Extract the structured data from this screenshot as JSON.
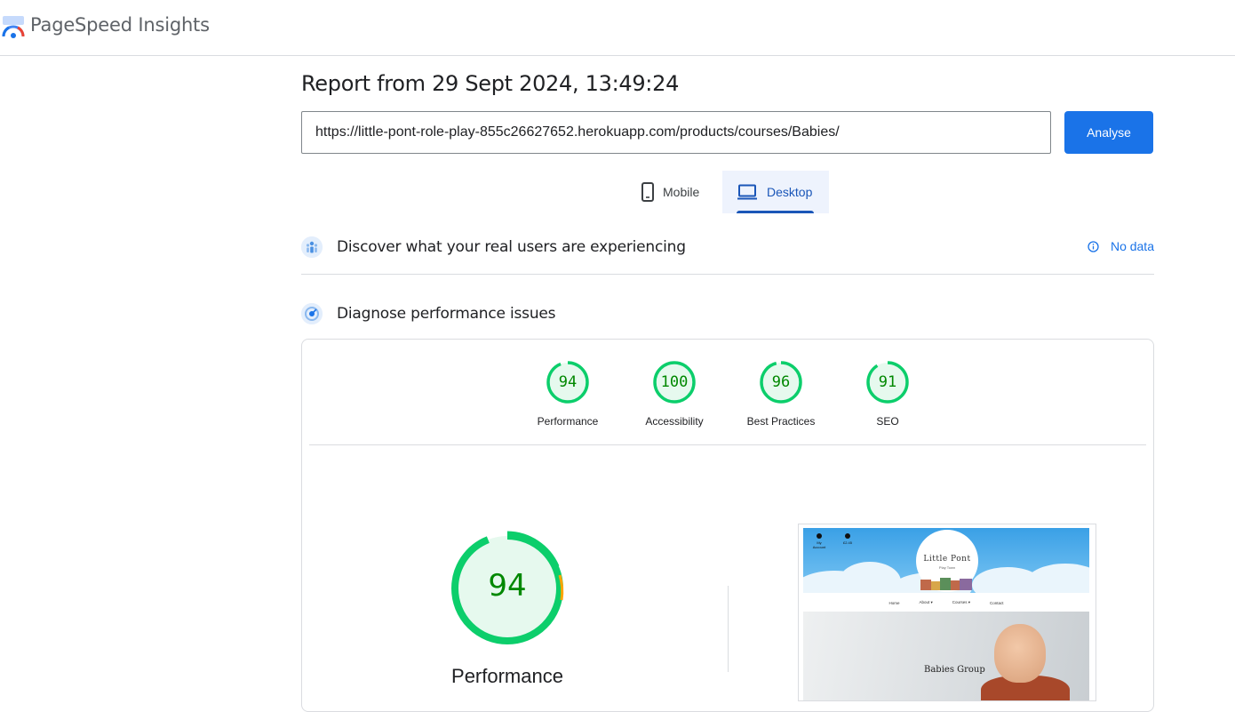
{
  "header": {
    "brand": "PageSpeed Insights"
  },
  "report": {
    "title": "Report from 29 Sept 2024, 13:49:24"
  },
  "search": {
    "url": "https://little-pont-role-play-855c26627652.herokuapp.com/products/courses/Babies/",
    "analyse_label": "Analyse"
  },
  "device_tabs": [
    {
      "label": "Mobile",
      "icon": "phone-icon",
      "selected": false
    },
    {
      "label": "Desktop",
      "icon": "laptop-icon",
      "selected": true
    }
  ],
  "crux": {
    "title": "Discover what your real users are experiencing",
    "status": "No data",
    "icon": "users-icon"
  },
  "diagnose": {
    "title": "Diagnose performance issues",
    "icon": "gauge-icon"
  },
  "scores": [
    {
      "value": "94",
      "label": "Performance"
    },
    {
      "value": "100",
      "label": "Accessibility"
    },
    {
      "value": "96",
      "label": "Best Practices"
    },
    {
      "value": "91",
      "label": "SEO"
    }
  ],
  "main_score": {
    "value": "94",
    "label": "Performance"
  },
  "thumbnail": {
    "logo_text": "Little Pont",
    "logo_sub": "Play  Town",
    "account_label": "My Account",
    "bag_label": "£2.45",
    "nav": [
      "Home",
      "About ▾",
      "Courses ▾",
      "Contact"
    ],
    "caption": "Babies Group"
  },
  "colors": {
    "accent": "#1a73e8",
    "pass": "#0cce6b",
    "pass_text": "#008800",
    "average": "#ffa400"
  }
}
